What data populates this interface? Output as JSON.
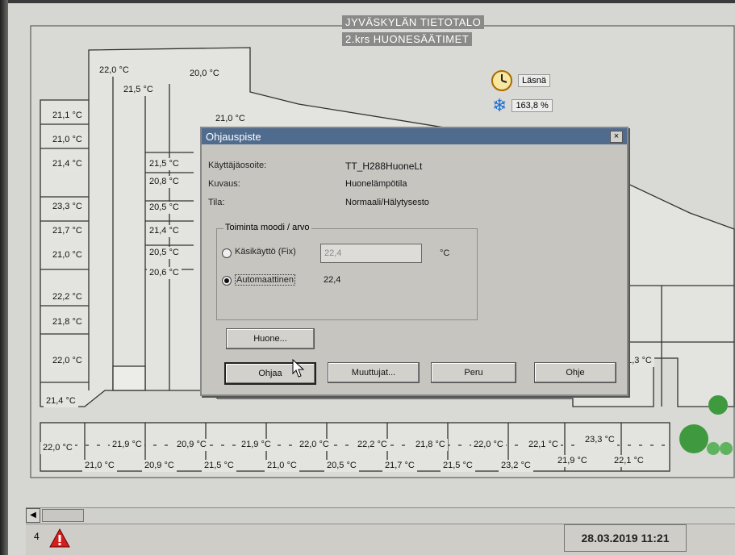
{
  "header": {
    "title_line1": "JYVÄSKYLÄN TIETOTALO",
    "title_line2": "2.krs HUONESÄÄTIMET"
  },
  "status": {
    "presence_icon": "clock-icon",
    "presence_label": "Läsnä",
    "cooling_icon": "snowflake-icon",
    "cooling_value": "163,8 %"
  },
  "rooms": [
    "22,0 °C",
    "20,0 °C",
    "21,5 °C",
    "21,1 °C",
    "21,0 °C",
    "21,4 °C",
    "21,5 °C",
    "20,8 °C",
    "23,3 °C",
    "20,5 °C",
    "21,7 °C",
    "21,4 °C",
    "21,0 °C",
    "20,5 °C",
    "20,6 °C",
    "22,2 °C",
    "21,8 °C",
    "22,0 °C",
    "21,4 °C",
    "22,0 °C",
    "21,9 °C",
    "20,9 °C",
    "21,9 °C",
    "22,0 °C",
    "22,2 °C",
    "21,8 °C",
    "22,0 °C",
    "22,1 °C",
    "23,3 °C",
    "21,0 °C",
    "20,9 °C",
    "21,5 °C",
    "21,0 °C",
    "20,5 °C",
    "21,7 °C",
    "21,5 °C",
    "23,2 °C",
    "21,9 °C",
    "22,1 °C",
    "21,3 °C",
    "°C",
    "21,0 °C"
  ],
  "dialog": {
    "title": "Ohjauspiste",
    "close_glyph": "×",
    "user_address_label": "Käyttäjäosoite:",
    "user_address_value": "TT_H288HuoneLt",
    "description_label": "Kuvaus:",
    "description_value": "Huonelämpötila",
    "state_label": "Tila:",
    "state_value": "Normaali/Hälytysesto",
    "group_label": "Toiminta moodi / arvo",
    "manual_label": "Käsikäyttö (Fix)",
    "manual_value": "22,4",
    "manual_unit": "°C",
    "auto_label": "Automaattinen",
    "auto_value": "22,4",
    "room_button": "Huone...",
    "control_button": "Ohjaa",
    "variables_button": "Muuttujat...",
    "cancel_button": "Peru",
    "help_button": "Ohje"
  },
  "footer": {
    "alarm_count": "4",
    "datetime": "28.03.2019 11:21"
  }
}
